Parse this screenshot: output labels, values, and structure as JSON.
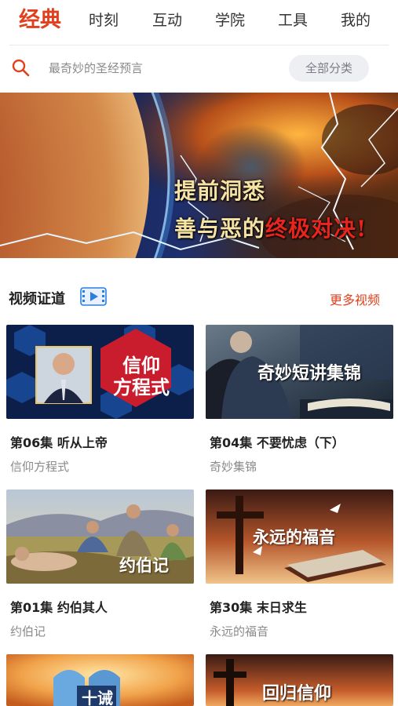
{
  "nav": {
    "tabs": [
      "经典",
      "时刻",
      "互动",
      "学院",
      "工具",
      "我的"
    ],
    "active_index": 0
  },
  "search": {
    "placeholder": "最奇妙的圣经预言",
    "category_label": "全部分类"
  },
  "banner": {
    "line1": "提前洞悉",
    "line2_part1": "善与恶的",
    "line2_part2": "终极对决!"
  },
  "section": {
    "title": "视频证道",
    "more_label": "更多视频"
  },
  "videos": [
    {
      "title": "第06集 听从上帝",
      "series": "信仰方程式",
      "thumb_text": [
        "信仰",
        "方程式"
      ]
    },
    {
      "title": "第04集 不要忧虑（下）",
      "series": "奇妙集锦",
      "thumb_text": [
        "奇妙短讲集锦"
      ]
    },
    {
      "title": "第01集 约伯其人",
      "series": "约伯记",
      "thumb_text": [
        "约伯记"
      ]
    },
    {
      "title": "第30集 末日求生",
      "series": "永远的福音",
      "thumb_text": [
        "永远的福音"
      ]
    },
    {
      "title": "",
      "series": "",
      "thumb_text": [
        "十诫"
      ]
    },
    {
      "title": "",
      "series": "",
      "thumb_text": [
        "回归信仰"
      ]
    }
  ],
  "colors": {
    "accent": "#e2401d",
    "muted": "#8a8a8a",
    "chip_bg": "#eeeff3"
  }
}
